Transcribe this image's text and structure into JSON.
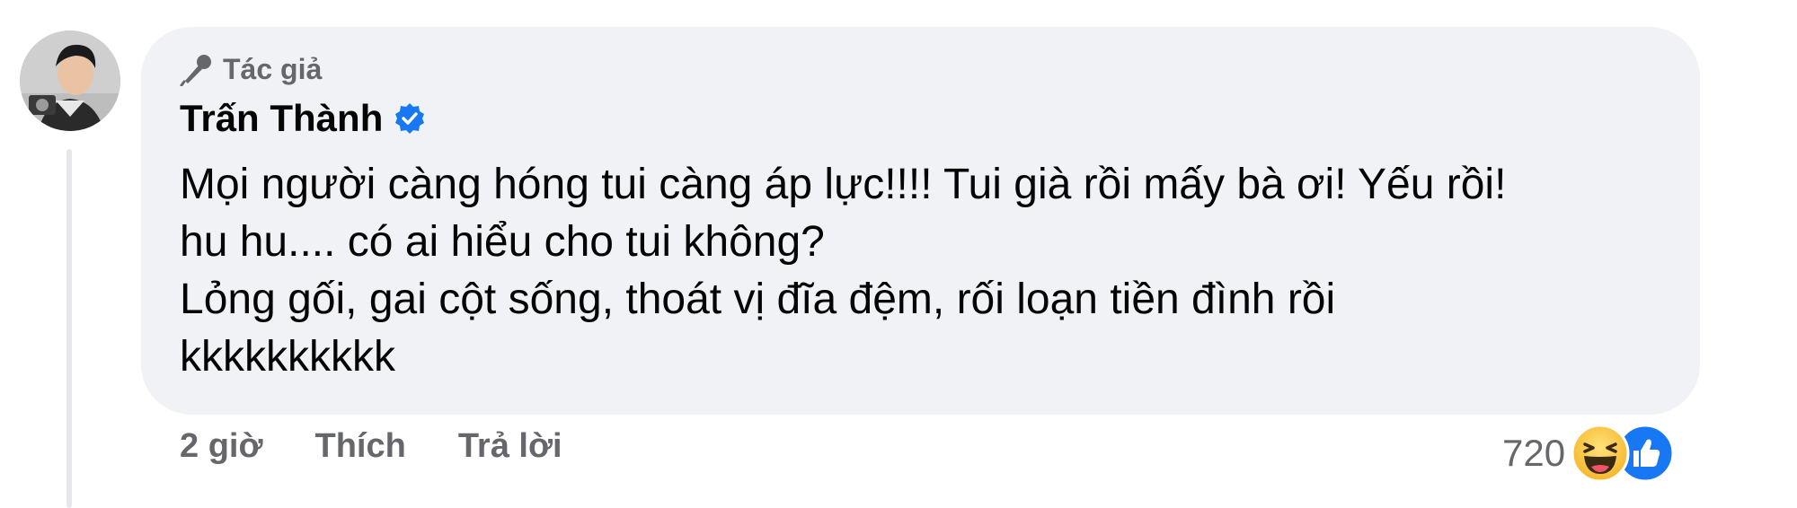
{
  "comment": {
    "badge_label": "Tác giả",
    "author_name": "Trấn Thành",
    "text_lines": [
      "Mọi người càng hóng tui càng áp lực!!!! Tui già rồi mấy bà ơi! Yếu rồi!",
      "hu hu.... có ai hiểu cho tui không?",
      "Lỏng gối, gai cột sống, thoát vị đĩa đệm, rối loạn tiền đình rồi",
      "kkkkkkkkkk"
    ],
    "time": "2 giờ",
    "like_label": "Thích",
    "reply_label": "Trả lời",
    "reaction_count": "720"
  },
  "colors": {
    "bubble_bg": "#f0f2f5",
    "verified_blue": "#1877f2",
    "secondary_text": "#65676b"
  },
  "icons": [
    "microphone-icon",
    "verified-badge-icon",
    "haha-reaction-icon",
    "like-reaction-icon"
  ]
}
